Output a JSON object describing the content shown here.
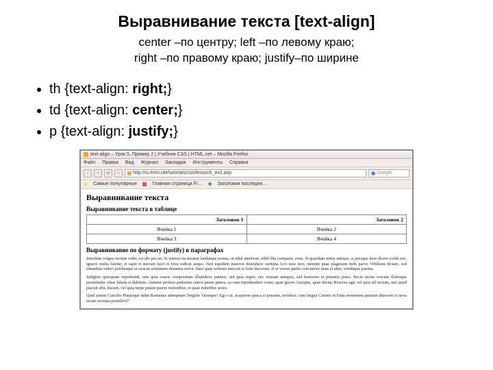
{
  "title": "Выравнивание текста [text-align]",
  "subtitle_line1": "center –по центру; left –по левому краю;",
  "subtitle_line2": "right –по правому краю; justify–по ширине",
  "bullets": [
    {
      "pre": "th {text-align: ",
      "val": "right;",
      "post": "}"
    },
    {
      "pre": "td {text-align: ",
      "val": "center;",
      "post": "}"
    },
    {
      "pre": "p {text-align: ",
      "val": "justify;",
      "post": "}"
    }
  ],
  "browser": {
    "title": "text-align – Урок 5, Пример 2 | Учебник CSS | HTML.net – Mozilla Firefox",
    "menu": [
      "Файл",
      "Правка",
      "Вид",
      "Журнал",
      "Закладки",
      "Инструменты",
      "Справка"
    ],
    "url": "http://ru.html.net/tutorials/css/lesson5_ex2.asp",
    "search_placeholder": "Google",
    "bookmarks": [
      "Самые популярные",
      "Главная страница Fi…",
      "Заголовки последни…"
    ]
  },
  "page": {
    "h1": "Выравнивание текста",
    "h2a": "Выравнивание текста в таблице",
    "table": {
      "headers": [
        "Заголовок 1",
        "Заголовок 2"
      ],
      "rows": [
        [
          "Ячейка 1",
          "Ячейка 2"
        ],
        [
          "Ячейка 3",
          "Ячейка 4"
        ]
      ]
    },
    "h2b": "Выравнивание по формату (justify) в параграфах",
    "p1": "Interdum volgus rectum videt, est ubi peccat. Si veteres ita miratur laudatque poetas, ut nihil anteferat, nihil illis comparet, errat. Si quaedam nimis antique, si peraque dure dicere credit eos, ignave multa fatetur, et sapit et mecum facit et Iova iudicat aequo. Non equidem insector delendave carmina Livi esse reor, memini quae plagosum mihi parvo Orbilium dictare, sed emendata videri pulchraque et exactis minimum distantia miror. Inter quae verbum emicuit si forte decorum, et si versus paulo concinnior unus et alter, venditque poema.",
    "p2": "Indignor quicquam reprehendi, non quia crasse compositum illepedeve putetur, sed quia nuper, nec veniam antiquis, sed honorem et praemia posci. Recte necne crocam floresque perambulet Attae fabula si dubitem, clament periisse pudorem cuncti paene patres, ea cum reprehendere coner, quae gravis Aesopus, quae doctus Roscius egit, vel quia nil rectum, nisi quod placuit sibi, ducunt, vel quia turpe putant parere minoribus, et quae imberbes senes.",
    "p3": "Quid autem Caecilio Plautoque dabit Romanus ademptum Vergilio Varioque? Ego cur, acquirere pauca si possum, invideor, cum lingua Catonis et Enni sermonem patrium ditaverit et nova rerum nomina protulerit?"
  }
}
